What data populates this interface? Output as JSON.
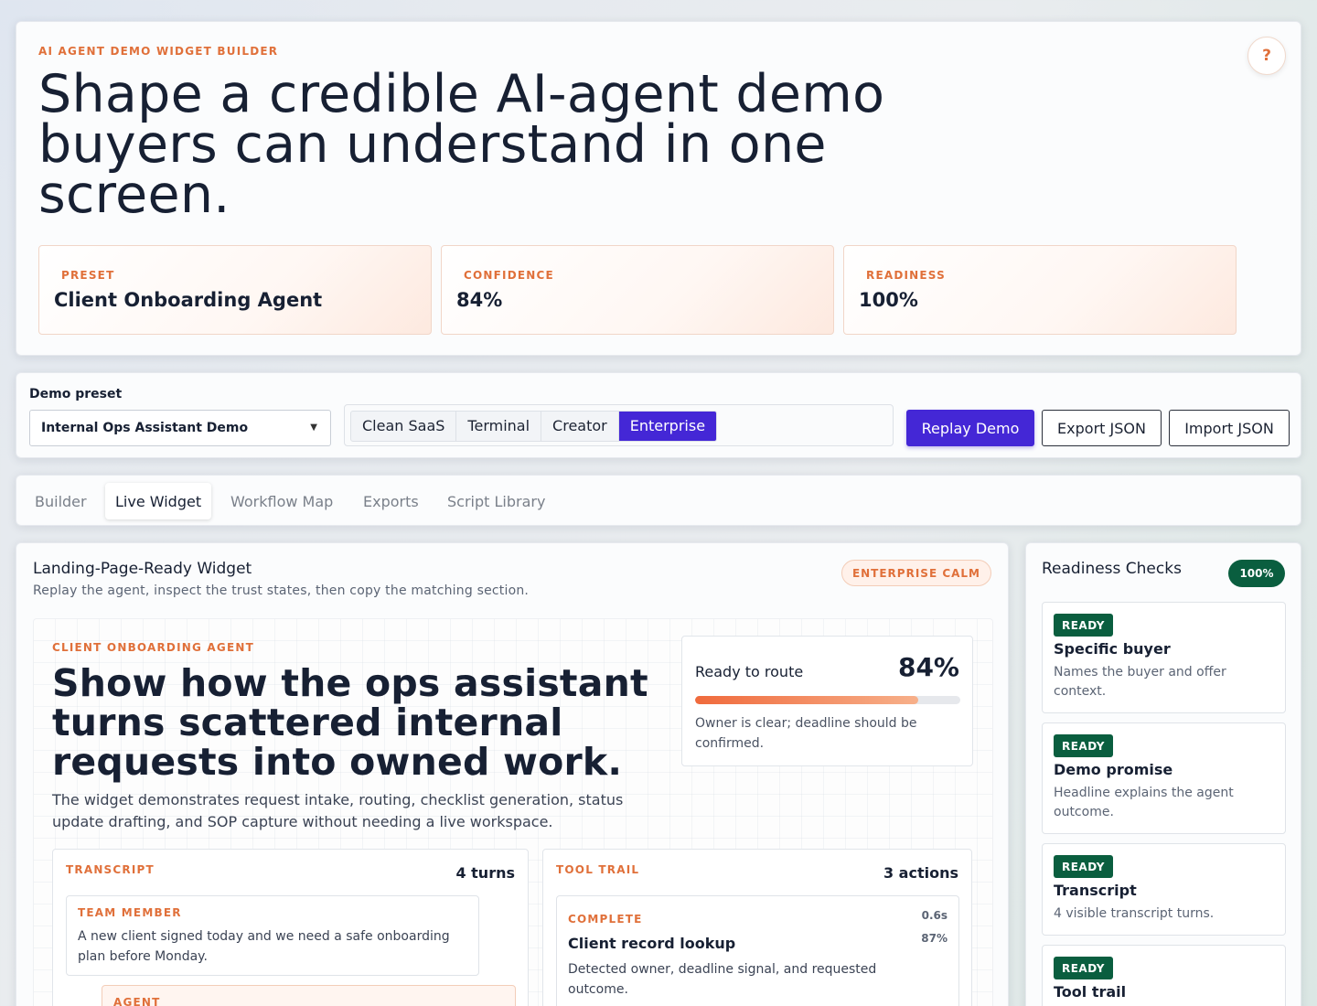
{
  "hero": {
    "eyebrow": "AI AGENT DEMO WIDGET BUILDER",
    "title": "Shape a credible AI-agent demo buyers can understand in one screen.",
    "help_label": "?",
    "stats": [
      {
        "label": "PRESET",
        "value": "Client Onboarding Agent"
      },
      {
        "label": "CONFIDENCE",
        "value": "84%"
      },
      {
        "label": "READINESS",
        "value": "100%"
      }
    ]
  },
  "controls": {
    "preset_label": "Demo preset",
    "preset_value": "Internal Ops Assistant Demo",
    "themes": [
      "Clean SaaS",
      "Terminal",
      "Creator",
      "Enterprise"
    ],
    "active_theme": "Enterprise",
    "replay_label": "Replay Demo",
    "export_label": "Export JSON",
    "import_label": "Import JSON",
    "accent_color": "#4427d6"
  },
  "tabs": [
    "Builder",
    "Live Widget",
    "Workflow Map",
    "Exports",
    "Script Library"
  ],
  "active_tab": "Live Widget",
  "main": {
    "title": "Landing-Page-Ready Widget",
    "subtitle": "Replay the agent, inspect the trust states, then copy the matching section.",
    "theme_badge": "ENTERPRISE CALM",
    "widget": {
      "eyebrow": "CLIENT ONBOARDING AGENT",
      "headline": "Show how the ops assistant turns scattered internal requests into owned work.",
      "description": "The widget demonstrates request intake, routing, checklist generation, status update drafting, and SOP capture without needing a live workspace.",
      "route": {
        "label": "Ready to route",
        "percent_text": "84%",
        "progress": 0.84,
        "note": "Owner is clear; deadline should be confirmed."
      },
      "transcript": {
        "label": "TRANSCRIPT",
        "count": "4 turns",
        "messages": [
          {
            "role": "TEAM MEMBER",
            "text": "A new client signed today and we need a safe onboarding plan before Monday."
          },
          {
            "role": "AGENT",
            "text": ""
          }
        ]
      },
      "tool_trail": {
        "label": "TOOL TRAIL",
        "count": "3 actions",
        "items": [
          {
            "status": "COMPLETE",
            "time": "0.6s",
            "confidence": "87%",
            "name": "Client record lookup",
            "description": "Detected owner, deadline signal, and requested outcome."
          }
        ]
      }
    }
  },
  "readiness": {
    "title": "Readiness Checks",
    "badge": "100%",
    "status_color": "#0a5e3f",
    "checks": [
      {
        "status": "READY",
        "name": "Specific buyer",
        "description": "Names the buyer and offer context."
      },
      {
        "status": "READY",
        "name": "Demo promise",
        "description": "Headline explains the agent outcome."
      },
      {
        "status": "READY",
        "name": "Transcript",
        "description": "4 visible transcript turns."
      },
      {
        "status": "READY",
        "name": "Tool trail",
        "description": ""
      }
    ]
  }
}
